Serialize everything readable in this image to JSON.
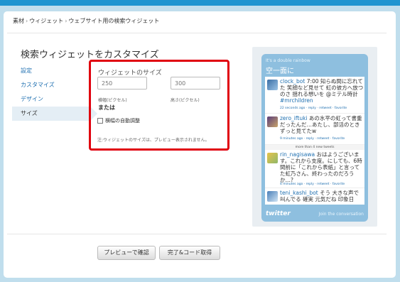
{
  "breadcrumb": [
    "素材",
    "ウィジェット",
    "ウェブサイト用の検索ウィジェット"
  ],
  "breadcrumb_sep": "›",
  "page_title": "検索ウィジェットをカスタマイズ",
  "nav": {
    "items": [
      {
        "label": "設定",
        "active": false
      },
      {
        "label": "カスタマイズ",
        "active": false
      },
      {
        "label": "デザイン",
        "active": false
      },
      {
        "label": "サイズ",
        "active": true
      }
    ]
  },
  "size": {
    "title": "ウィジェットのサイズ",
    "width_value": "",
    "width_placeholder": "250",
    "height_value": "",
    "height_placeholder": "300",
    "width_label": "横幅(ピクセル)",
    "height_label": "高さ(ピクセル)",
    "or_text": "または",
    "autowidth_label": "横幅の自動調整",
    "autowidth_checked": false,
    "note": "注:ウィジェットのサイズは、プレビュー表示されません。"
  },
  "widget": {
    "subtitle": "It's a double rainbow",
    "title": "空一面に",
    "tweets": [
      {
        "user": "clock_bot",
        "text": " 7:00 知らぬ間に忘れてた 笑顔など見せて 虹の彼方へ放つのさ 揺れる想いを @ミテル時計 ",
        "link": "#mrchildren",
        "meta": "22 seconds ago",
        "actions": " · reply · retweet · favorite"
      },
      {
        "user": "zero_iftuki",
        "text": " あの水平の虹って書重だったんだ…あたし、部活のときずっと見てたw",
        "link": "",
        "meta": "9 minutes ago",
        "actions": " · reply · retweet · favorite"
      },
      {
        "user": "rin_nagisawa",
        "text": " おはようございます。これから支度。にしても、6時間前に「これから表紙」と言ってた虹乃さん、終わったのだろうか…?",
        "link": "",
        "meta": "4 minutes ago",
        "actions": " · reply · retweet · favorite"
      },
      {
        "user": "teni_kashi_bot",
        "text": " そう 大きな声で叫んでる 確実 元気だね 印象日",
        "link": "",
        "meta": "",
        "actions": ""
      }
    ],
    "more": "more than 4 new tweets",
    "logo": "twitter",
    "join": "Join the conversation"
  },
  "buttons": {
    "preview": "プレビューで確認",
    "complete": "完了&コード取得"
  },
  "colors": {
    "accent": "#1e94d0",
    "highlight": "#e0000e",
    "widget_bg": "#8ebfdf",
    "link": "#1e6fb0"
  }
}
